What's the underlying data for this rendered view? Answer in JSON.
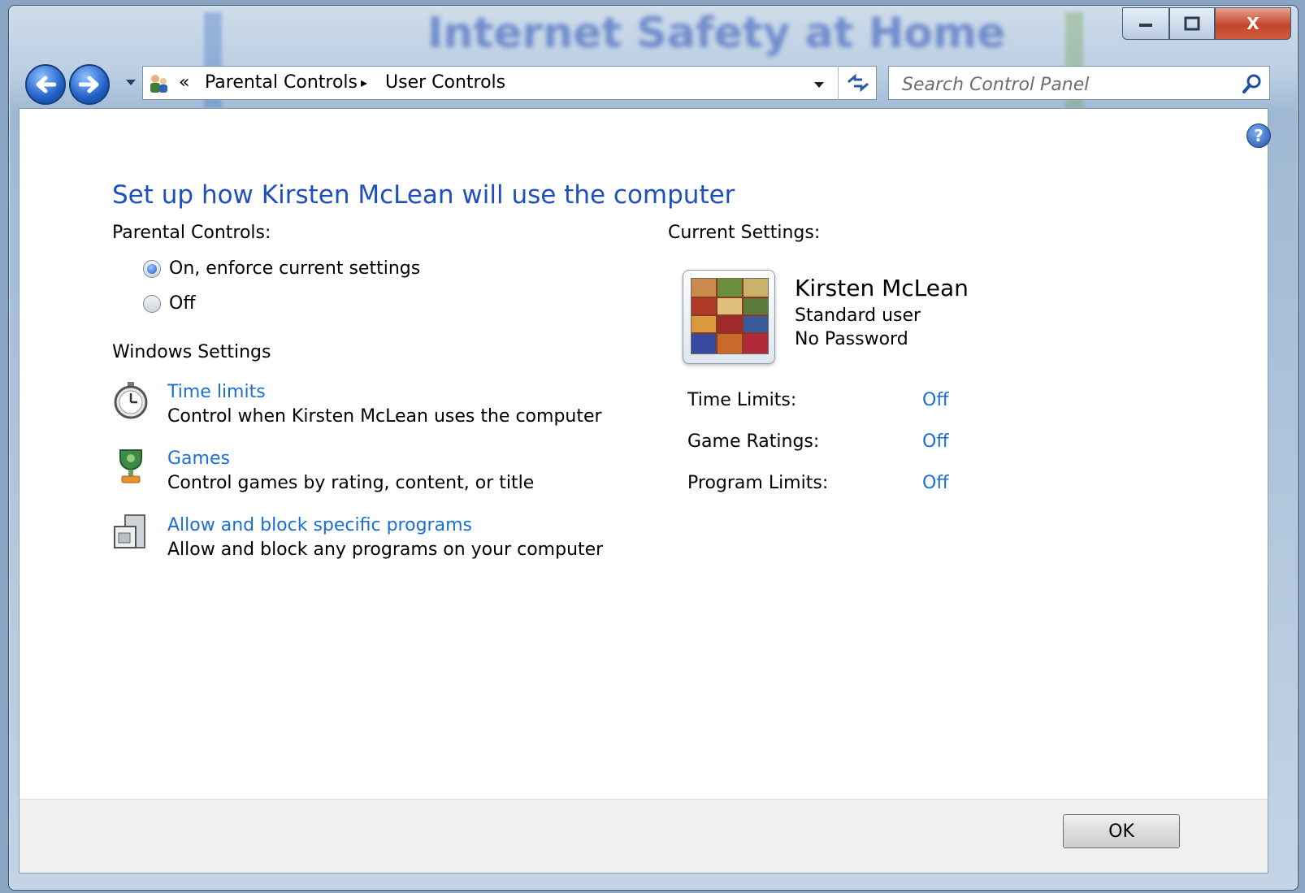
{
  "window": {
    "background_title": "Internet Safety at Home",
    "minimize_label": "",
    "maximize_label": "",
    "close_label": "X"
  },
  "navigation": {
    "back_icon": "back-arrow-icon",
    "forward_icon": "forward-arrow-icon",
    "recent_pages_icon": "chevron-down-icon",
    "address": {
      "overflow_chevron": "«",
      "crumbs": [
        "Parental Controls",
        "User Controls"
      ],
      "separator": "▸"
    },
    "refresh_icon": "refresh-icon"
  },
  "search": {
    "placeholder": "Search Control Panel",
    "icon": "search-icon"
  },
  "page": {
    "heading": "Set up how Kirsten McLean will use the computer",
    "parental_controls_label": "Parental Controls:",
    "radio_on": "On, enforce current settings",
    "radio_off": "Off",
    "selected": "On, enforce current settings",
    "windows_settings_label": "Windows Settings",
    "tasks": [
      {
        "icon": "stopwatch-icon",
        "link": "Time limits",
        "desc": "Control when Kirsten McLean uses the computer"
      },
      {
        "icon": "trophy-icon",
        "link": "Games",
        "desc": "Control games by rating, content, or title"
      },
      {
        "icon": "programs-icon",
        "link": "Allow and block specific programs",
        "desc": "Allow and block any programs on your computer"
      }
    ],
    "current_settings_label": "Current Settings:",
    "user": {
      "name": "Kirsten McLean",
      "type": "Standard user",
      "password": "No Password"
    },
    "settings": [
      {
        "label": "Time Limits:",
        "value": "Off"
      },
      {
        "label": "Game Ratings:",
        "value": "Off"
      },
      {
        "label": "Program Limits:",
        "value": "Off"
      }
    ]
  },
  "footer": {
    "ok_label": "OK"
  },
  "colors": {
    "link": "#1a6fd6",
    "heading": "#1e4fbe"
  }
}
